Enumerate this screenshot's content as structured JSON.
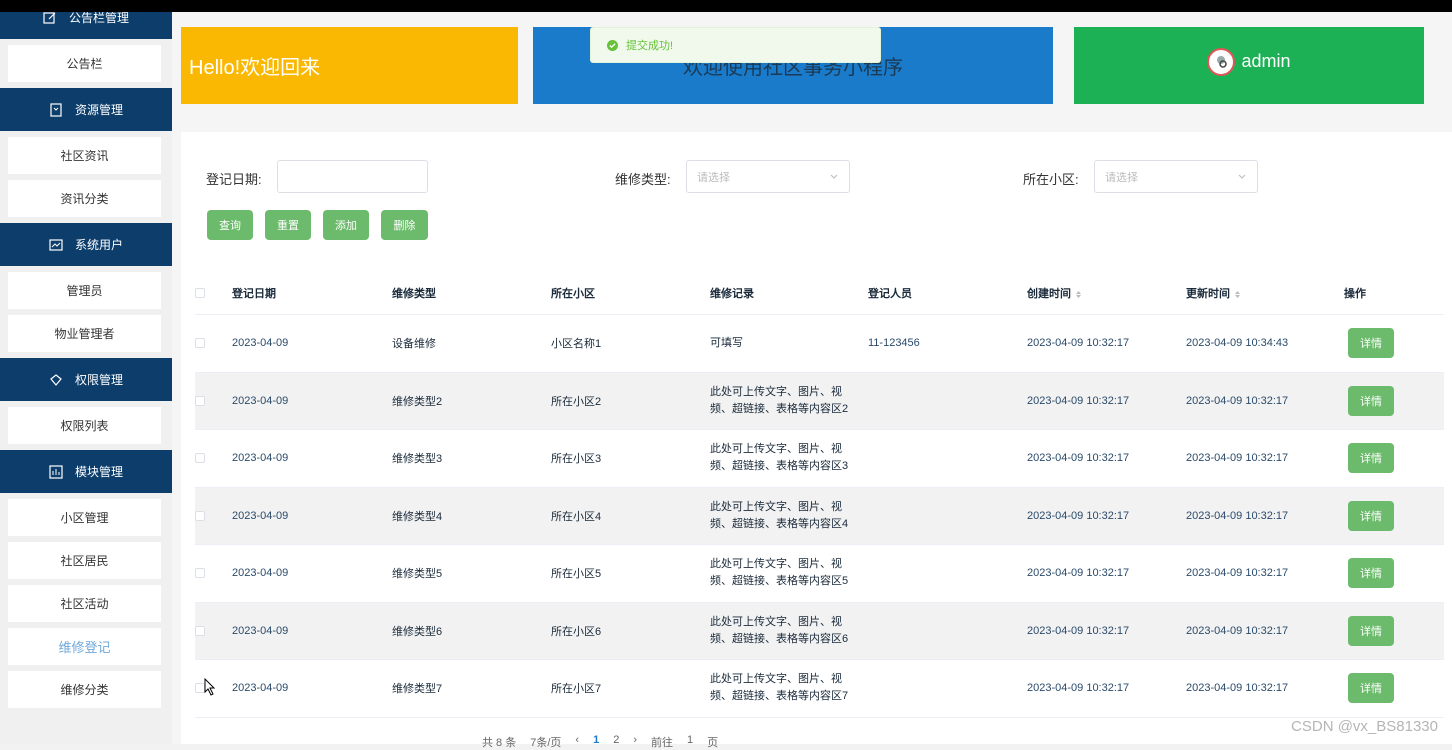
{
  "sidebar": {
    "groups": [
      {
        "label": "公告栏管理",
        "icon": "edit-icon",
        "items": [
          "公告栏"
        ]
      },
      {
        "label": "资源管理",
        "icon": "document-icon",
        "items": [
          "社区资讯",
          "资讯分类"
        ]
      },
      {
        "label": "系统用户",
        "icon": "chart-icon",
        "items": [
          "管理员",
          "物业管理者"
        ]
      },
      {
        "label": "权限管理",
        "icon": "diamond-icon",
        "items": [
          "权限列表"
        ]
      },
      {
        "label": "模块管理",
        "icon": "bar-chart-icon",
        "items": [
          "小区管理",
          "社区居民",
          "社区活动",
          "维修登记",
          "维修分类"
        ]
      }
    ],
    "active_item": "维修登记"
  },
  "banners": {
    "welcome": "Hello!欢迎回来",
    "app_name": "欢迎使用社区事务小程序",
    "user": "admin"
  },
  "toast": {
    "message": "提交成功!"
  },
  "filters": {
    "date_label": "登记日期:",
    "date_value": "",
    "type_label": "维修类型:",
    "type_placeholder": "请选择",
    "community_label": "所在小区:",
    "community_placeholder": "请选择"
  },
  "buttons": {
    "query": "查询",
    "reset": "重置",
    "add": "添加",
    "delete": "删除"
  },
  "table": {
    "headers": [
      "登记日期",
      "维修类型",
      "所在小区",
      "维修记录",
      "登记人员",
      "创建时间",
      "更新时间",
      "操作"
    ],
    "detail_label": "详情",
    "rows": [
      {
        "date": "2023-04-09",
        "type": "设备维修",
        "community": "小区名称1",
        "record1": "可填写",
        "record2": "",
        "person": "11-123456",
        "created": "2023-04-09 10:32:17",
        "updated": "2023-04-09 10:34:43"
      },
      {
        "date": "2023-04-09",
        "type": "维修类型2",
        "community": "所在小区2",
        "record1": "此处可上传文字、图片、视",
        "record2": "频、超链接、表格等内容区2",
        "person": "",
        "created": "2023-04-09 10:32:17",
        "updated": "2023-04-09 10:32:17"
      },
      {
        "date": "2023-04-09",
        "type": "维修类型3",
        "community": "所在小区3",
        "record1": "此处可上传文字、图片、视",
        "record2": "频、超链接、表格等内容区3",
        "person": "",
        "created": "2023-04-09 10:32:17",
        "updated": "2023-04-09 10:32:17"
      },
      {
        "date": "2023-04-09",
        "type": "维修类型4",
        "community": "所在小区4",
        "record1": "此处可上传文字、图片、视",
        "record2": "频、超链接、表格等内容区4",
        "person": "",
        "created": "2023-04-09 10:32:17",
        "updated": "2023-04-09 10:32:17"
      },
      {
        "date": "2023-04-09",
        "type": "维修类型5",
        "community": "所在小区5",
        "record1": "此处可上传文字、图片、视",
        "record2": "频、超链接、表格等内容区5",
        "person": "",
        "created": "2023-04-09 10:32:17",
        "updated": "2023-04-09 10:32:17"
      },
      {
        "date": "2023-04-09",
        "type": "维修类型6",
        "community": "所在小区6",
        "record1": "此处可上传文字、图片、视",
        "record2": "频、超链接、表格等内容区6",
        "person": "",
        "created": "2023-04-09 10:32:17",
        "updated": "2023-04-09 10:32:17"
      },
      {
        "date": "2023-04-09",
        "type": "维修类型7",
        "community": "所在小区7",
        "record1": "此处可上传文字、图片、视",
        "record2": "频、超链接、表格等内容区7",
        "person": "",
        "created": "2023-04-09 10:32:17",
        "updated": "2023-04-09 10:32:17"
      }
    ]
  },
  "pager": {
    "total": "共 8 条",
    "size": "7条/页",
    "page1": "1",
    "page2": "2",
    "goto": "前往",
    "goto_value": "1",
    "page_unit": "页"
  },
  "watermark": "CSDN @vx_BS81330",
  "colors": {
    "sidebar_header": "#0d3e6b",
    "yellow": "#fbb802",
    "blue": "#1b7bcb",
    "green": "#1db155",
    "button": "#6cba6c"
  }
}
